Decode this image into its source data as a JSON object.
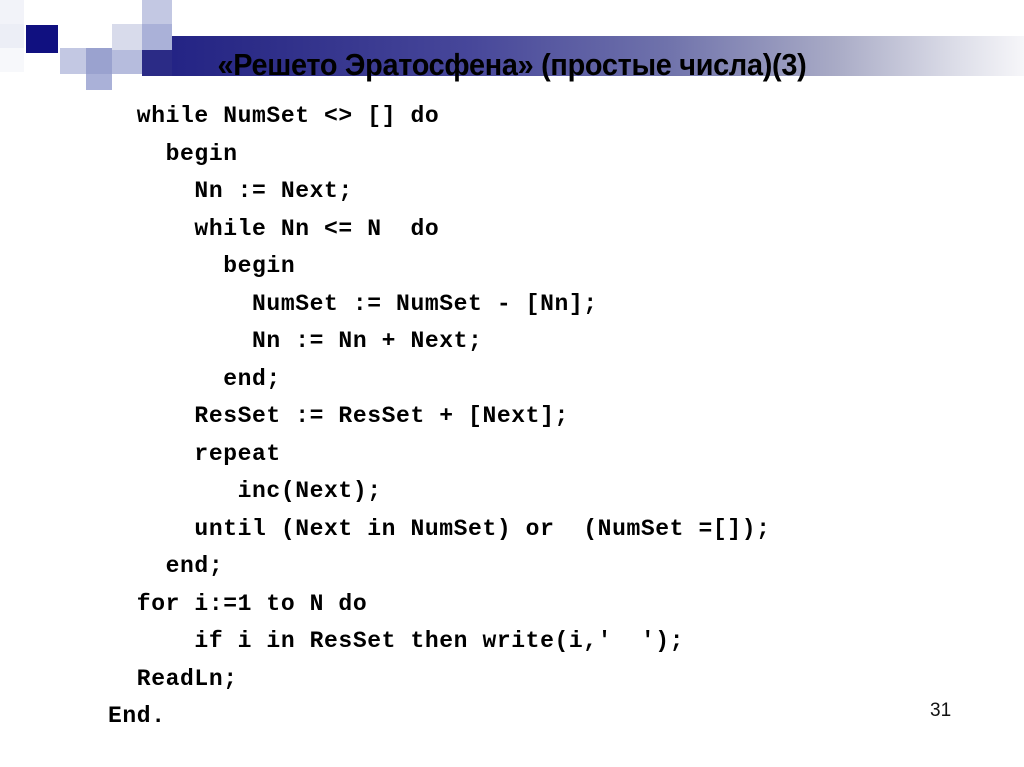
{
  "slide": {
    "title": "«Решето Эратосфена» (простые числа)(3)",
    "page_number": "31"
  },
  "decoration": {
    "navy": "#101080",
    "mid_blue": "#2b2b86",
    "periwinkle": "#9aa2cf",
    "lavender": "#c3c8e3",
    "pale": "#dcdde8",
    "gradient_from": "#242485",
    "gradient_to": "#f6f6f9"
  },
  "code": {
    "language": "pascal",
    "lines": [
      "  while NumSet <> [] do",
      "    begin",
      "      Nn := Next;",
      "      while Nn <= N  do",
      "        begin",
      "          NumSet := NumSet - [Nn];",
      "          Nn := Nn + Next;",
      "        end;",
      "      ResSet := ResSet + [Next];",
      "      repeat",
      "         inc(Next);",
      "      until (Next in NumSet) or  (NumSet =[]);",
      "    end;",
      "  for i:=1 to N do",
      "      if i in ResSet then write(i,'  ');",
      "  ReadLn;",
      "End."
    ]
  }
}
